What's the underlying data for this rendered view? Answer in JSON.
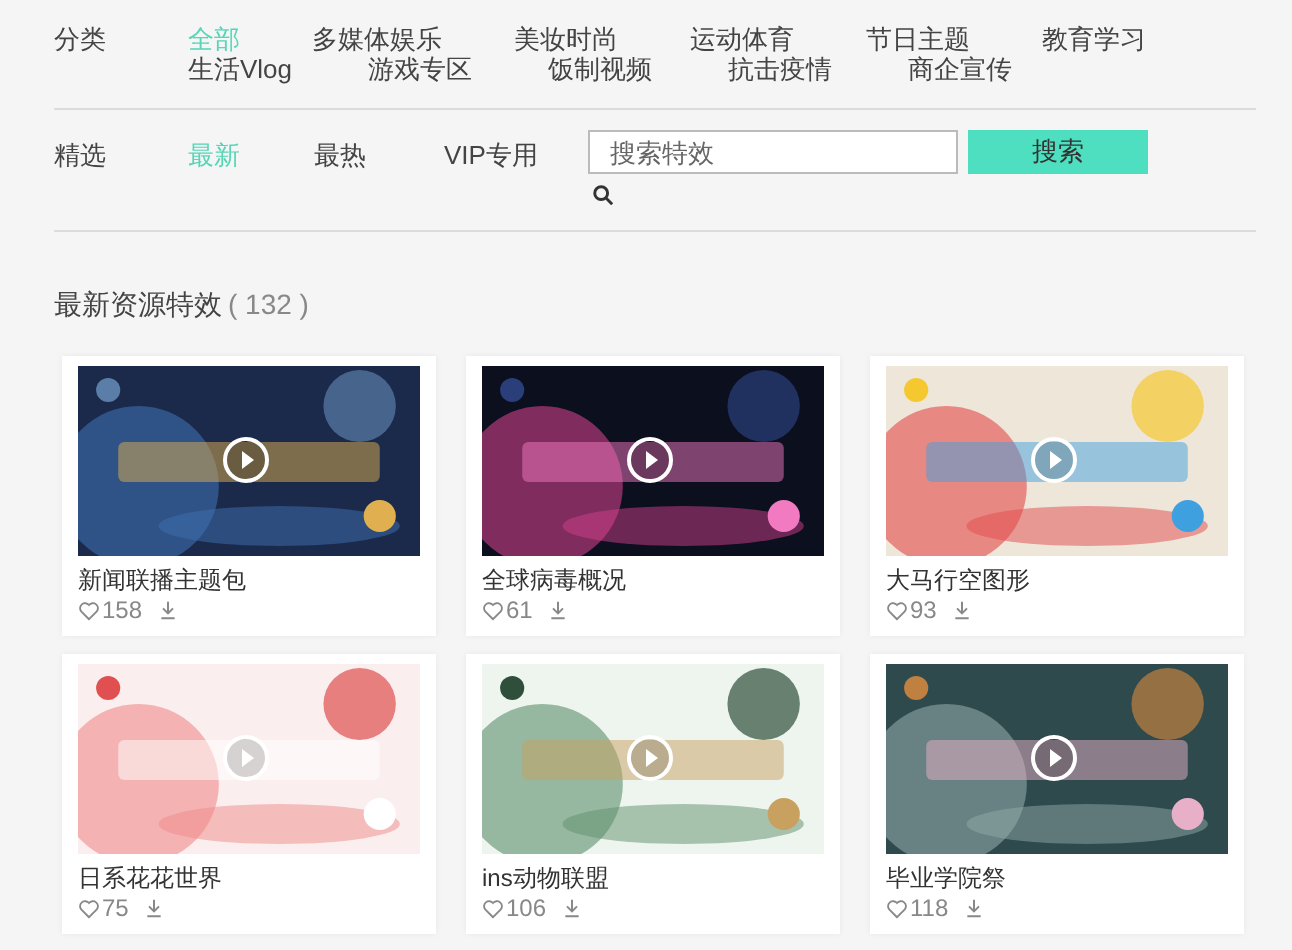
{
  "category_filter": {
    "label": "分类",
    "items": [
      {
        "label": "全部",
        "selected": true
      },
      {
        "label": "多媒体娱乐",
        "selected": false
      },
      {
        "label": "美妆时尚",
        "selected": false
      },
      {
        "label": "运动体育",
        "selected": false
      },
      {
        "label": "节日主题",
        "selected": false
      },
      {
        "label": "教育学习",
        "selected": false
      },
      {
        "label": "生活Vlog",
        "selected": false
      },
      {
        "label": "游戏专区",
        "selected": false
      },
      {
        "label": "饭制视频",
        "selected": false
      },
      {
        "label": "抗击疫情",
        "selected": false
      },
      {
        "label": "商企宣传",
        "selected": false
      }
    ]
  },
  "sort_filter": {
    "label": "精选",
    "items": [
      {
        "label": "最新",
        "selected": true
      },
      {
        "label": "最热",
        "selected": false
      },
      {
        "label": "VIP专用",
        "selected": false
      }
    ]
  },
  "search": {
    "placeholder": "搜索特效",
    "button": "搜索"
  },
  "section": {
    "title": "最新资源特效",
    "count": "( 132 )"
  },
  "cards": [
    {
      "title": "新闻联播主题包",
      "likes": "158"
    },
    {
      "title": "全球病毒概况",
      "likes": "61"
    },
    {
      "title": "大马行空图形",
      "likes": "93"
    },
    {
      "title": "日系花花世界",
      "likes": "75"
    },
    {
      "title": "ins动物联盟",
      "likes": "106"
    },
    {
      "title": "毕业学院祭",
      "likes": "118"
    }
  ]
}
